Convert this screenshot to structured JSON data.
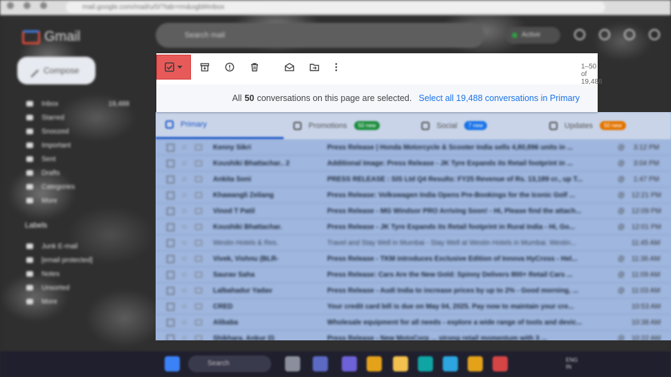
{
  "browser": {
    "url": "mail.google.com/mail/u/0/?tab=rm&ogbl#inbox"
  },
  "app": {
    "logo_text": "Gmail",
    "compose_label": "Compose",
    "search_placeholder": "Search mail",
    "status_label": "Active"
  },
  "sidebar": {
    "items": [
      {
        "label": "Inbox",
        "count": "19,488"
      },
      {
        "label": "Starred"
      },
      {
        "label": "Snoozed"
      },
      {
        "label": "Important"
      },
      {
        "label": "Sent"
      },
      {
        "label": "Drafts"
      },
      {
        "label": "Categories"
      },
      {
        "label": "More"
      }
    ],
    "labels_title": "Labels",
    "labels": [
      {
        "label": "Junk E-mail"
      },
      {
        "label": "[email protected]"
      },
      {
        "label": "Notes"
      },
      {
        "label": "Unsorted"
      },
      {
        "label": "More"
      }
    ]
  },
  "toolbar": {
    "pager": "1–50 of 19,488"
  },
  "selection": {
    "prefix": "All",
    "count": "50",
    "suffix": "conversations on this page are selected.",
    "select_all_link": "Select all 19,488 conversations in Primary"
  },
  "categories": [
    {
      "label": "Primary",
      "badge": ""
    },
    {
      "label": "Promotions",
      "badge": "50 new",
      "badge_color": "#1e8e3e"
    },
    {
      "label": "Social",
      "badge": "7 new",
      "badge_color": "#1a73e8"
    },
    {
      "label": "Updates",
      "badge": "50 new",
      "badge_color": "#e37400"
    }
  ],
  "emails": [
    {
      "sender": "Kenny Sikri",
      "subject": "Press Release | Honda Motorcycle & Scooter India sells 4,80,896 units in ...",
      "tag": "@",
      "time": "3:12 PM",
      "read": false
    },
    {
      "sender": "Koushiki Bhattachar.. 2",
      "subject": "Additional Image: Press Release - JK Tyre Expands its Retail footprint in ...",
      "tag": "@",
      "time": "3:04 PM",
      "read": false
    },
    {
      "sender": "Ankita Soni",
      "subject": "PRESS RELEASE : SIS Ltd Q4 Results: FY25 Revenue of Rs. 13,189 cr., up T...",
      "tag": "@",
      "time": "1:47 PM",
      "read": false
    },
    {
      "sender": "Khawangli Zeliang",
      "subject": "Press Release: Volkswagen India Opens Pre-Bookings for the Iconic Golf ...",
      "tag": "@",
      "time": "12:21 PM",
      "read": false
    },
    {
      "sender": "Vinod T Patil",
      "subject": "Press Release - MG Windsor PRO Arriving Soon! - Hi, Please find the attach...",
      "tag": "@",
      "time": "12:09 PM",
      "read": false
    },
    {
      "sender": "Koushiki Bhattachar.",
      "subject": "Press Release - JK Tyre Expands its Retail footprint in Rural India - Hi, Go...",
      "tag": "@",
      "time": "12:01 PM",
      "read": false
    },
    {
      "sender": "Westin Hotels & Res.",
      "subject": "Travel and Stay Well in Mumbai - Stay Well at Westin Hotels in Mumbai. Westin...",
      "tag": "",
      "time": "11:45 AM",
      "read": true
    },
    {
      "sender": "Vivek, Vishnu (BLR-",
      "subject": "Press Release - TKM introduces Exclusive Edition of Innova HyCross - Hel...",
      "tag": "@",
      "time": "11:36 AM",
      "read": false
    },
    {
      "sender": "Saurav Saha",
      "subject": "Press Release: Cars Are the New Gold: Spinny Delivers 800+ Retail Cars ...",
      "tag": "@",
      "time": "11:09 AM",
      "read": false
    },
    {
      "sender": "Lalbahadur Yadav",
      "subject": "Press Release - Audi India to increase prices by up to 2% - Good morning, ...",
      "tag": "@",
      "time": "11:03 AM",
      "read": false
    },
    {
      "sender": "CRED",
      "subject": "Your credit card bill is due on May 04, 2025. Pay now to maintain your cre...",
      "tag": "",
      "time": "10:53 AM",
      "read": false
    },
    {
      "sender": "Alibaba",
      "subject": "Wholesale equipment for all needs - explore a wide range of tools and devic...",
      "tag": "",
      "time": "10:38 AM",
      "read": false
    },
    {
      "sender": "Shikhara, Ankur (I)",
      "subject": "Press Release - New MotoCorp ... strong retail momentum with 3 ...",
      "tag": "@",
      "time": "10:22 AM",
      "read": false
    }
  ],
  "taskbar": {
    "search_label": "Search",
    "clock_line1": "ENG",
    "clock_line2": "IN"
  },
  "colors": {
    "select_highlight": "#e85a5a",
    "link": "#1a73e8",
    "selected_row": "#9fb6de"
  }
}
